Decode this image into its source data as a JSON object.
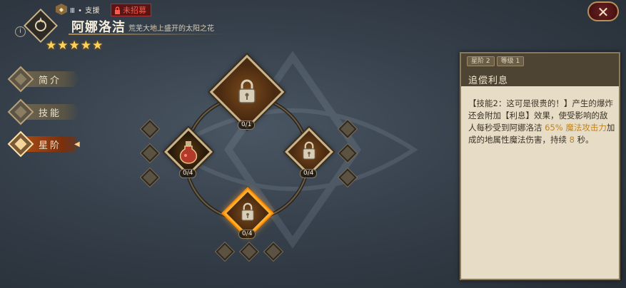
{
  "hero": {
    "class_icon": "support-class-icon",
    "class_label": "Ⅲ • 支援",
    "status_label": "未招募",
    "name": "阿娜洛洁",
    "subtitle": "荒芜大地上盛开的太阳之花",
    "stars": [
      "★",
      "★",
      "★",
      "★",
      "★"
    ],
    "info_glyph": "i"
  },
  "close_glyph": "✕",
  "menu": [
    {
      "label": "简介",
      "icon": "profile-icon"
    },
    {
      "label": "技能",
      "icon": "skill-icon"
    },
    {
      "label": "星阶",
      "icon": "star-rank-icon",
      "active": true
    }
  ],
  "tree": {
    "nodes": [
      {
        "id": "top",
        "count": "0/1",
        "locked": true
      },
      {
        "id": "left",
        "count": "0/4",
        "locked": false,
        "icon": "potion-icon"
      },
      {
        "id": "right",
        "count": "0/4",
        "locked": true
      },
      {
        "id": "bottom",
        "count": "0/4",
        "locked": true,
        "selected": true
      }
    ]
  },
  "panel": {
    "tags": [
      "星阶 2",
      "等级 1"
    ],
    "title": "追偿利息",
    "desc_parts": [
      {
        "text": "【技能2：这可是很贵的！】产生的爆炸还会附加【利息】效果，使受影响的敌人每秒受到阿娜洛洁 ",
        "hl": false
      },
      {
        "text": "65% 魔法攻击力",
        "hl": true
      },
      {
        "text": "加成的地属性魔法伤害，持续 ",
        "hl": false
      },
      {
        "text": "8",
        "hl": true
      },
      {
        "text": " 秒。",
        "hl": false
      }
    ]
  },
  "colors": {
    "accent": "#ffb02e",
    "highlight": "#c0821c",
    "locked_red": "#ff5b4a"
  }
}
